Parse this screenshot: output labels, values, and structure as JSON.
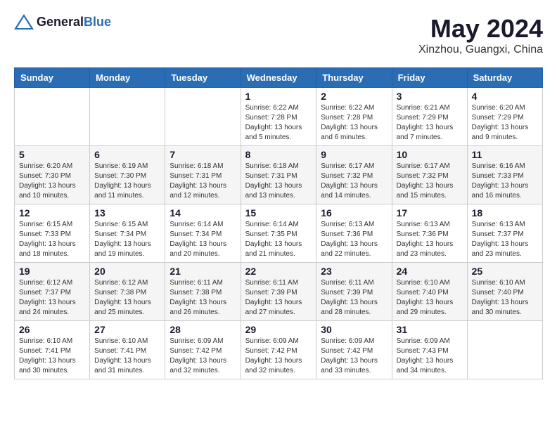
{
  "header": {
    "logo_general": "General",
    "logo_blue": "Blue",
    "month": "May 2024",
    "location": "Xinzhou, Guangxi, China"
  },
  "columns": [
    "Sunday",
    "Monday",
    "Tuesday",
    "Wednesday",
    "Thursday",
    "Friday",
    "Saturday"
  ],
  "weeks": [
    [
      {
        "day": "",
        "sunrise": "",
        "sunset": "",
        "daylight": ""
      },
      {
        "day": "",
        "sunrise": "",
        "sunset": "",
        "daylight": ""
      },
      {
        "day": "",
        "sunrise": "",
        "sunset": "",
        "daylight": ""
      },
      {
        "day": "1",
        "sunrise": "Sunrise: 6:22 AM",
        "sunset": "Sunset: 7:28 PM",
        "daylight": "Daylight: 13 hours and 5 minutes."
      },
      {
        "day": "2",
        "sunrise": "Sunrise: 6:22 AM",
        "sunset": "Sunset: 7:28 PM",
        "daylight": "Daylight: 13 hours and 6 minutes."
      },
      {
        "day": "3",
        "sunrise": "Sunrise: 6:21 AM",
        "sunset": "Sunset: 7:29 PM",
        "daylight": "Daylight: 13 hours and 7 minutes."
      },
      {
        "day": "4",
        "sunrise": "Sunrise: 6:20 AM",
        "sunset": "Sunset: 7:29 PM",
        "daylight": "Daylight: 13 hours and 9 minutes."
      }
    ],
    [
      {
        "day": "5",
        "sunrise": "Sunrise: 6:20 AM",
        "sunset": "Sunset: 7:30 PM",
        "daylight": "Daylight: 13 hours and 10 minutes."
      },
      {
        "day": "6",
        "sunrise": "Sunrise: 6:19 AM",
        "sunset": "Sunset: 7:30 PM",
        "daylight": "Daylight: 13 hours and 11 minutes."
      },
      {
        "day": "7",
        "sunrise": "Sunrise: 6:18 AM",
        "sunset": "Sunset: 7:31 PM",
        "daylight": "Daylight: 13 hours and 12 minutes."
      },
      {
        "day": "8",
        "sunrise": "Sunrise: 6:18 AM",
        "sunset": "Sunset: 7:31 PM",
        "daylight": "Daylight: 13 hours and 13 minutes."
      },
      {
        "day": "9",
        "sunrise": "Sunrise: 6:17 AM",
        "sunset": "Sunset: 7:32 PM",
        "daylight": "Daylight: 13 hours and 14 minutes."
      },
      {
        "day": "10",
        "sunrise": "Sunrise: 6:17 AM",
        "sunset": "Sunset: 7:32 PM",
        "daylight": "Daylight: 13 hours and 15 minutes."
      },
      {
        "day": "11",
        "sunrise": "Sunrise: 6:16 AM",
        "sunset": "Sunset: 7:33 PM",
        "daylight": "Daylight: 13 hours and 16 minutes."
      }
    ],
    [
      {
        "day": "12",
        "sunrise": "Sunrise: 6:15 AM",
        "sunset": "Sunset: 7:33 PM",
        "daylight": "Daylight: 13 hours and 18 minutes."
      },
      {
        "day": "13",
        "sunrise": "Sunrise: 6:15 AM",
        "sunset": "Sunset: 7:34 PM",
        "daylight": "Daylight: 13 hours and 19 minutes."
      },
      {
        "day": "14",
        "sunrise": "Sunrise: 6:14 AM",
        "sunset": "Sunset: 7:34 PM",
        "daylight": "Daylight: 13 hours and 20 minutes."
      },
      {
        "day": "15",
        "sunrise": "Sunrise: 6:14 AM",
        "sunset": "Sunset: 7:35 PM",
        "daylight": "Daylight: 13 hours and 21 minutes."
      },
      {
        "day": "16",
        "sunrise": "Sunrise: 6:13 AM",
        "sunset": "Sunset: 7:36 PM",
        "daylight": "Daylight: 13 hours and 22 minutes."
      },
      {
        "day": "17",
        "sunrise": "Sunrise: 6:13 AM",
        "sunset": "Sunset: 7:36 PM",
        "daylight": "Daylight: 13 hours and 23 minutes."
      },
      {
        "day": "18",
        "sunrise": "Sunrise: 6:13 AM",
        "sunset": "Sunset: 7:37 PM",
        "daylight": "Daylight: 13 hours and 23 minutes."
      }
    ],
    [
      {
        "day": "19",
        "sunrise": "Sunrise: 6:12 AM",
        "sunset": "Sunset: 7:37 PM",
        "daylight": "Daylight: 13 hours and 24 minutes."
      },
      {
        "day": "20",
        "sunrise": "Sunrise: 6:12 AM",
        "sunset": "Sunset: 7:38 PM",
        "daylight": "Daylight: 13 hours and 25 minutes."
      },
      {
        "day": "21",
        "sunrise": "Sunrise: 6:11 AM",
        "sunset": "Sunset: 7:38 PM",
        "daylight": "Daylight: 13 hours and 26 minutes."
      },
      {
        "day": "22",
        "sunrise": "Sunrise: 6:11 AM",
        "sunset": "Sunset: 7:39 PM",
        "daylight": "Daylight: 13 hours and 27 minutes."
      },
      {
        "day": "23",
        "sunrise": "Sunrise: 6:11 AM",
        "sunset": "Sunset: 7:39 PM",
        "daylight": "Daylight: 13 hours and 28 minutes."
      },
      {
        "day": "24",
        "sunrise": "Sunrise: 6:10 AM",
        "sunset": "Sunset: 7:40 PM",
        "daylight": "Daylight: 13 hours and 29 minutes."
      },
      {
        "day": "25",
        "sunrise": "Sunrise: 6:10 AM",
        "sunset": "Sunset: 7:40 PM",
        "daylight": "Daylight: 13 hours and 30 minutes."
      }
    ],
    [
      {
        "day": "26",
        "sunrise": "Sunrise: 6:10 AM",
        "sunset": "Sunset: 7:41 PM",
        "daylight": "Daylight: 13 hours and 30 minutes."
      },
      {
        "day": "27",
        "sunrise": "Sunrise: 6:10 AM",
        "sunset": "Sunset: 7:41 PM",
        "daylight": "Daylight: 13 hours and 31 minutes."
      },
      {
        "day": "28",
        "sunrise": "Sunrise: 6:09 AM",
        "sunset": "Sunset: 7:42 PM",
        "daylight": "Daylight: 13 hours and 32 minutes."
      },
      {
        "day": "29",
        "sunrise": "Sunrise: 6:09 AM",
        "sunset": "Sunset: 7:42 PM",
        "daylight": "Daylight: 13 hours and 32 minutes."
      },
      {
        "day": "30",
        "sunrise": "Sunrise: 6:09 AM",
        "sunset": "Sunset: 7:42 PM",
        "daylight": "Daylight: 13 hours and 33 minutes."
      },
      {
        "day": "31",
        "sunrise": "Sunrise: 6:09 AM",
        "sunset": "Sunset: 7:43 PM",
        "daylight": "Daylight: 13 hours and 34 minutes."
      },
      {
        "day": "",
        "sunrise": "",
        "sunset": "",
        "daylight": ""
      }
    ]
  ]
}
